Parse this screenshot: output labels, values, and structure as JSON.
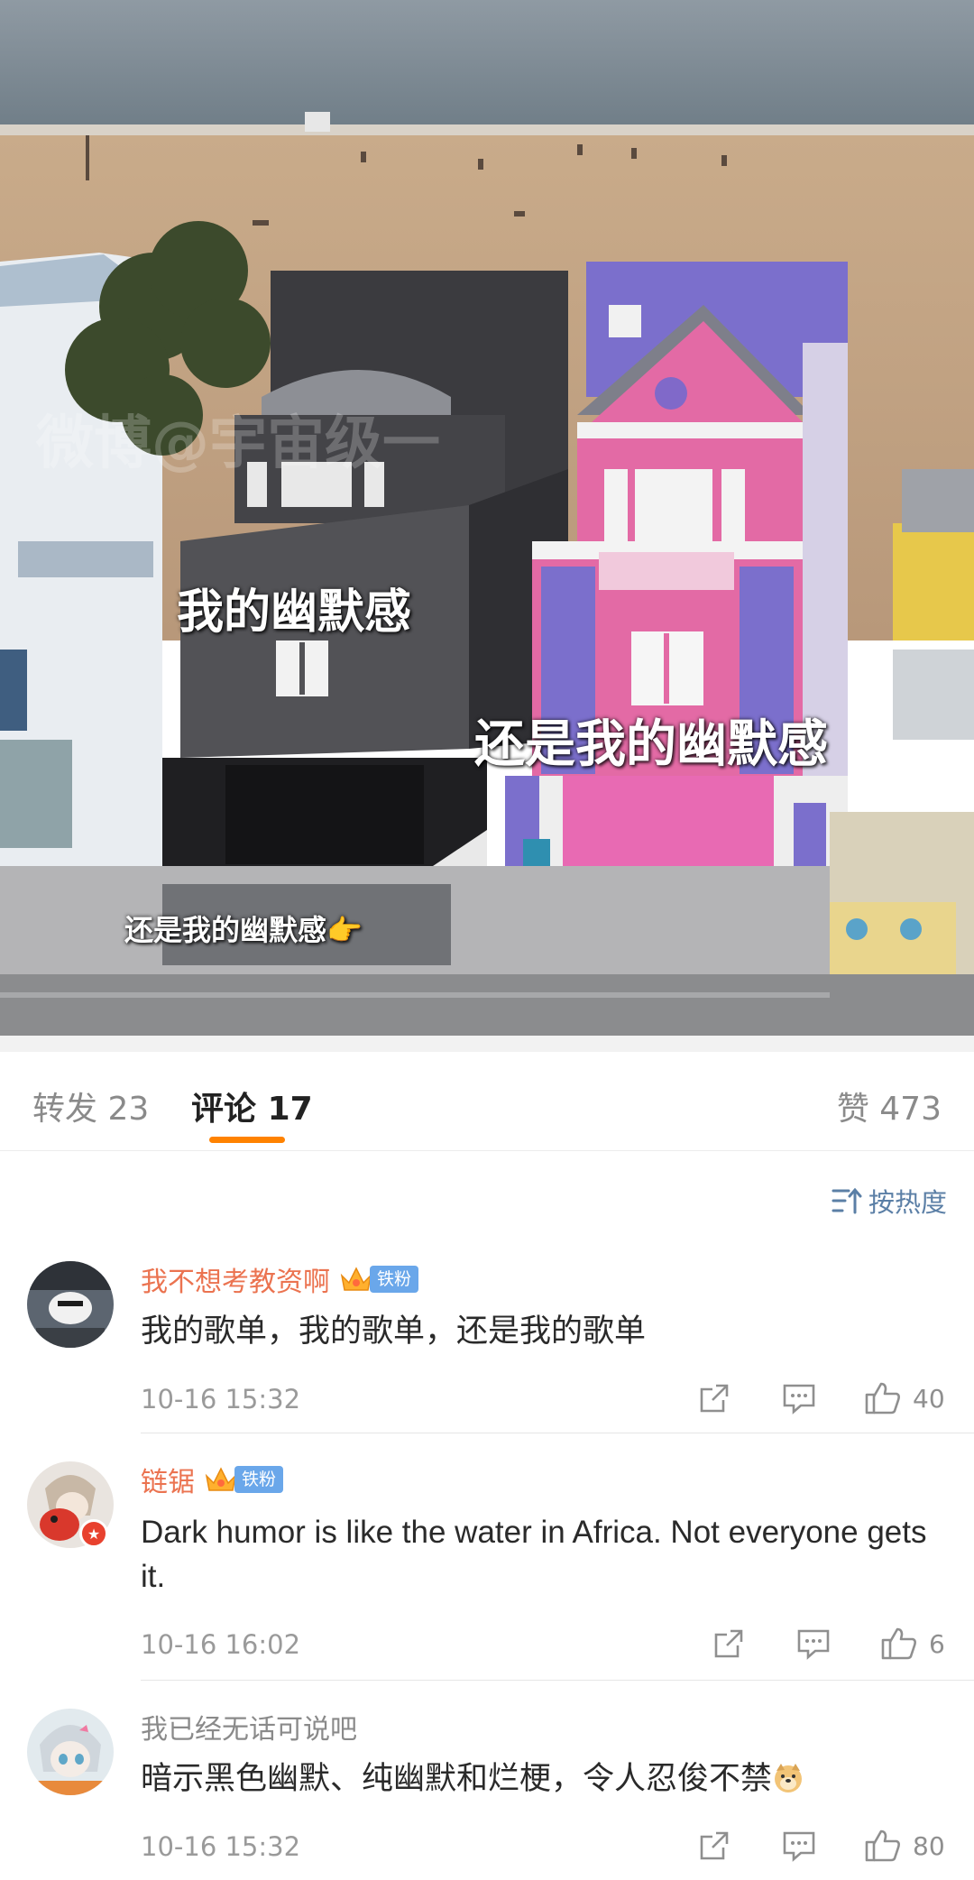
{
  "post_image": {
    "watermark": "微博@宇宙级一",
    "captions": [
      "我的幽默感",
      "还是我的幽默感",
      "还是我的幽默感👉"
    ]
  },
  "tabs": {
    "repost": {
      "label": "转发",
      "count": "23"
    },
    "comments": {
      "label": "评论",
      "count": "17",
      "active": true
    },
    "likes": {
      "label": "赞",
      "count": "473"
    }
  },
  "sort": {
    "label": "按热度",
    "icon": "sort-by-heat-icon"
  },
  "comments": [
    {
      "username": "我不想考教资啊",
      "badge": "铁粉",
      "text": "我的歌单，我的歌单，还是我的歌单",
      "time": "10-16 15:32",
      "likes": "40"
    },
    {
      "username": "链锯",
      "badge": "铁粉",
      "text": "Dark humor is like the water in Africa.   Not everyone gets it.",
      "time": "10-16 16:02",
      "likes": "6"
    },
    {
      "username": "我已经无话可说吧",
      "badge": "",
      "text": "暗示黑色幽默、纯幽默和烂梗，令人忍俊不禁",
      "time": "10-16 15:32",
      "likes": "80"
    }
  ],
  "colors": {
    "accent": "#ff8200",
    "username": "#eb7350",
    "link": "#5b7fa6",
    "fan_badge": "#6aa7ea"
  }
}
